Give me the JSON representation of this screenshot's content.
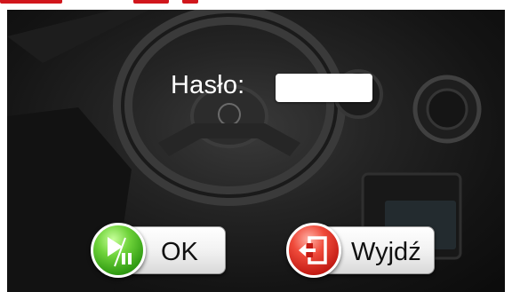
{
  "login": {
    "password_label": "Hasło:",
    "password_value": "",
    "ok_label": "OK",
    "exit_label": "Wyjdź"
  },
  "colors": {
    "ok_icon": "#4fbf22",
    "exit_icon": "#d52a20",
    "top_mark": "#d1161c"
  },
  "icons": {
    "ok": "play-pause-icon",
    "exit": "exit-door-icon"
  }
}
